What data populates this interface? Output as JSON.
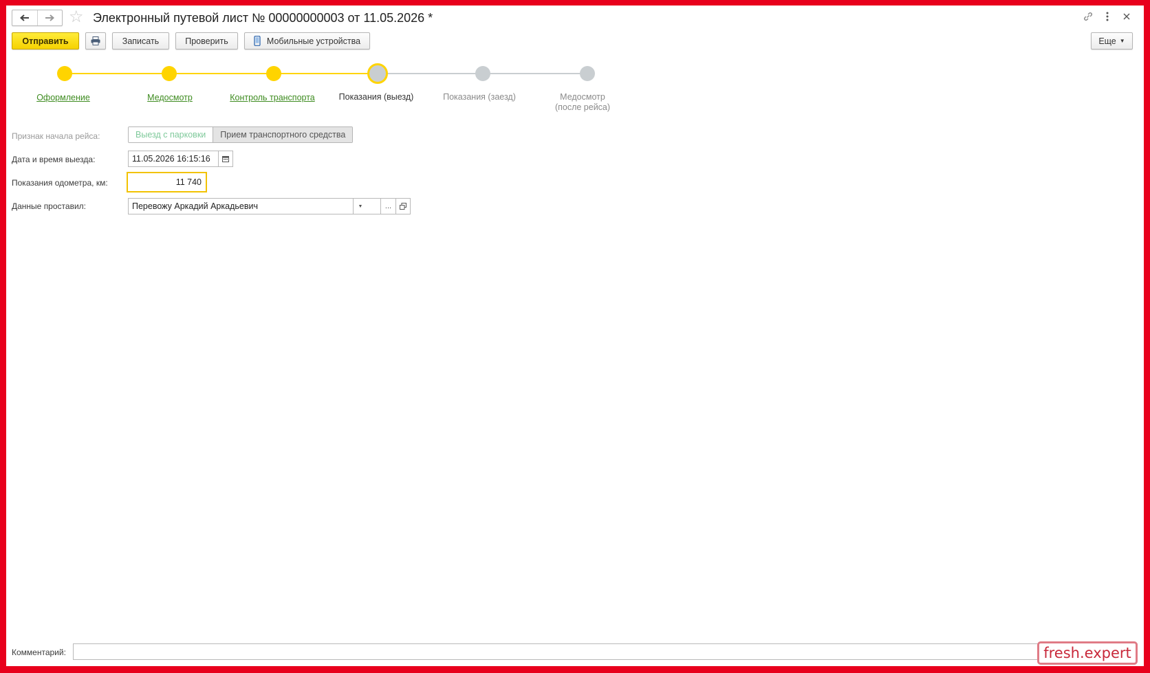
{
  "window": {
    "title": "Электронный путевой лист № 00000000003 от 11.05.2026 *"
  },
  "toolbar": {
    "send_label": "Отправить",
    "save_label": "Записать",
    "check_label": "Проверить",
    "mobile_label": "Мобильные устройства",
    "more_label": "Еще"
  },
  "steps": [
    {
      "label": "Оформление",
      "state": "done"
    },
    {
      "label": "Медосмотр",
      "state": "done"
    },
    {
      "label": "Контроль транспорта",
      "state": "done"
    },
    {
      "label": "Показания (выезд)",
      "state": "current"
    },
    {
      "label": "Показания (заезд)",
      "state": "todo"
    },
    {
      "label": "Медосмотр\n(после рейса)",
      "state": "todo"
    }
  ],
  "form": {
    "trip_start_label": "Признак начала рейса:",
    "trip_start_options": [
      "Выезд с парковки",
      "Прием транспортного средства"
    ],
    "trip_start_selected": "Выезд с парковки",
    "departure_label": "Дата и время выезда:",
    "departure_value": "11.05.2026 16:15:16",
    "odometer_label": "Показания одометра, км:",
    "odometer_value": "11 740",
    "entered_by_label": "Данные проставил:",
    "entered_by_value": "Перевожу Аркадий Аркадьевич",
    "ellipsis": "...",
    "comment_label": "Комментарий:",
    "comment_value": ""
  },
  "watermark": "fresh.expert",
  "colors": {
    "accent": "#ffd400",
    "link": "#3d8b1f",
    "frame": "#e8001c"
  }
}
